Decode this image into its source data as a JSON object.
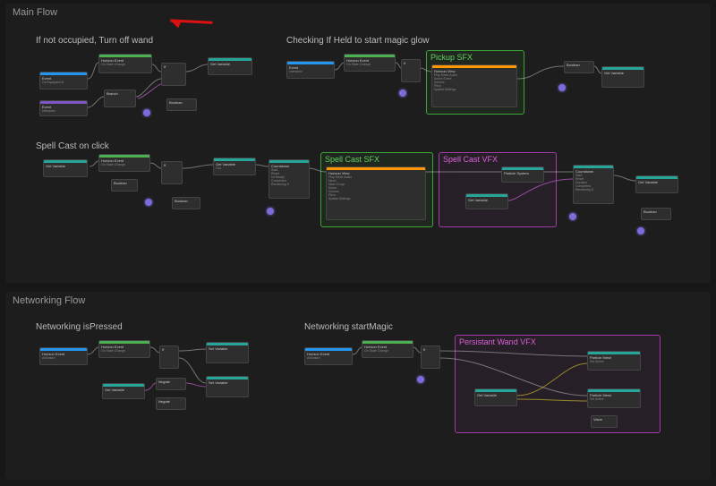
{
  "sections": {
    "main": {
      "title": "Main Flow"
    },
    "net": {
      "title": "Networking Flow"
    }
  },
  "comments": {
    "turn_off": "If not occupied, Turn off wand",
    "check_held": "Checking If Held to start magic glow",
    "spell_cast": "Spell Cast on click",
    "net_pressed": "Networking isPressed",
    "net_magic": "Networking startMagic"
  },
  "groups": {
    "pickup_sfx": "Pickup SFX",
    "spell_sfx": "Spell Cast SFX",
    "spell_vfx": "Spell Cast VFX",
    "persist_vfx": "Persistant Wand VFX"
  },
  "nodes": {
    "event_attached": {
      "title": "Event",
      "sub": "On Equipped M"
    },
    "event_interactor": {
      "title": "Event",
      "sub": "Interactor"
    },
    "state_change1": {
      "title": "Horizon Event",
      "sub": "On State Change"
    },
    "branch": {
      "title": "Branch",
      "sub": ""
    },
    "boolean": {
      "title": "Boolean",
      "sub": ""
    },
    "get_var1": {
      "title": "Get Variable",
      "sub": ""
    },
    "event_interact2": {
      "title": "Event",
      "sub": "Interactor"
    },
    "state_change2": {
      "title": "Horizon Event",
      "sub": "On State Change"
    },
    "if": {
      "title": "If",
      "sub": ""
    },
    "play_audio": {
      "title": "Horizon View",
      "sub": "Play Mesh Audio",
      "rows": [
        "Active Event",
        "Volume",
        "Pitch",
        "Spatial Settings"
      ]
    },
    "boolean2": {
      "title": "Boolean",
      "sub": ""
    },
    "get_var2": {
      "title": "Get Variable",
      "sub": ""
    },
    "spell_event": {
      "title": "Horizon Event",
      "sub": "On State Change"
    },
    "get_var_sc": {
      "title": "Get Variable",
      "sub": ""
    },
    "if2": {
      "title": "If",
      "sub": ""
    },
    "countdown": {
      "title": "Countdown",
      "sub": "",
      "rows": [
        "Start",
        "Reset",
        "Int Ready",
        "Completed",
        "Remaining S"
      ]
    },
    "get_var3": {
      "title": "Get Variable",
      "sub": "Out"
    },
    "play_audio2": {
      "title": "Horizon View",
      "sub": "Play Mesh Audio",
      "rows": [
        "Mesh",
        "Main Group",
        "Music",
        "Volume",
        "Pitch",
        "Spatial Settings",
        "Active Event"
      ]
    },
    "particle": {
      "title": "Particle System",
      "sub": ""
    },
    "get_var4": {
      "title": "Get Variable",
      "sub": ""
    },
    "countdown2": {
      "title": "Countdown",
      "sub": "",
      "rows": [
        "Start",
        "Reset",
        "Duration",
        "Completed",
        "Remaining S"
      ]
    },
    "get_var5": {
      "title": "Get Variable",
      "sub": ""
    },
    "boolean3": {
      "title": "Boolean",
      "sub": ""
    },
    "net_event1": {
      "title": "Horizon Event",
      "sub": "Activated"
    },
    "net_state1": {
      "title": "Horizon Event",
      "sub": "On State Change"
    },
    "net_if1": {
      "title": "If",
      "sub": ""
    },
    "negate1": {
      "title": "Negate",
      "sub": ""
    },
    "negate2": {
      "title": "Negate",
      "sub": ""
    },
    "net_getvar": {
      "title": "Get Variable",
      "sub": ""
    },
    "net_setvar1": {
      "title": "Set Variable",
      "sub": ""
    },
    "net_setvar2": {
      "title": "Set Variable",
      "sub": ""
    },
    "net_event2": {
      "title": "Horizon Event",
      "sub": "Activated"
    },
    "net_state2": {
      "title": "Horizon Event",
      "sub": "On State Change"
    },
    "net_if2": {
      "title": "If",
      "sub": ""
    },
    "net_getvar2": {
      "title": "Get Variable",
      "sub": ""
    },
    "set_active1": {
      "title": "Particle Mesh",
      "sub": "Set Active"
    },
    "set_active2": {
      "title": "Particle Mesh",
      "sub": "Set Active"
    },
    "value": {
      "title": "Value",
      "sub": ""
    }
  }
}
